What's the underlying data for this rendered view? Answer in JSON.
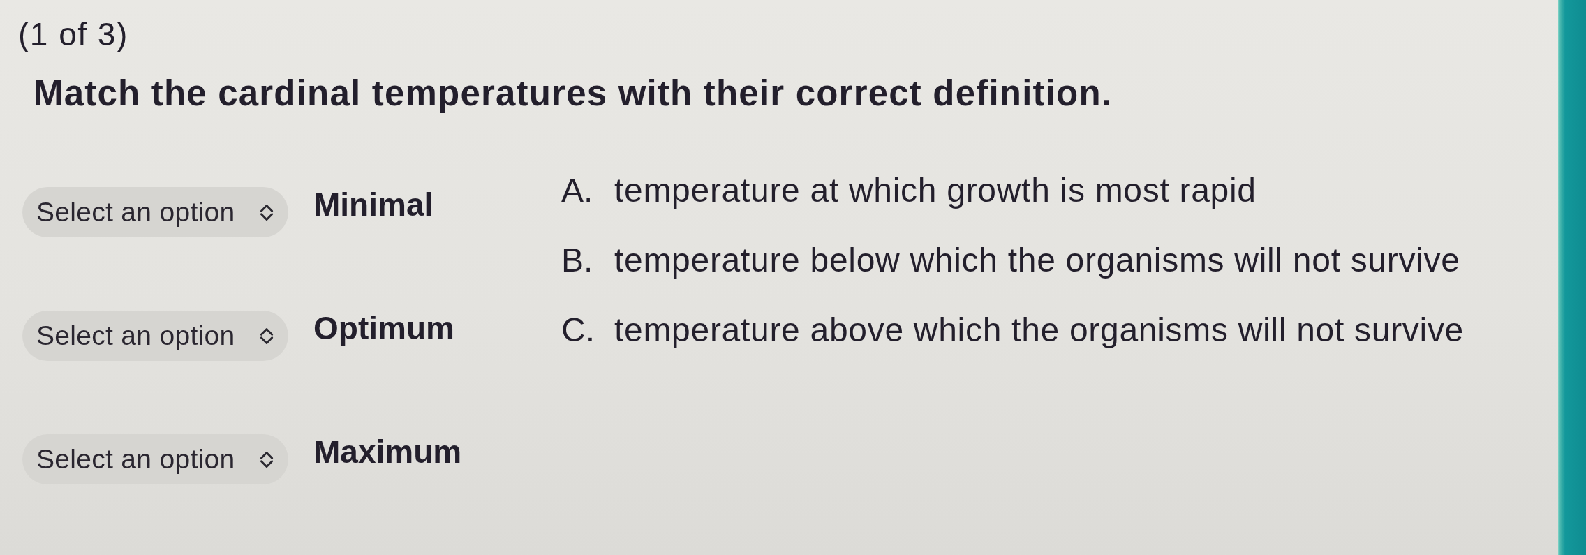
{
  "header": {
    "progress": "(1 of 3)",
    "question": "Match the cardinal temperatures with their correct definition."
  },
  "matches": [
    {
      "select": {
        "placeholder": "Select an option"
      },
      "term": "Minimal"
    },
    {
      "select": {
        "placeholder": "Select an option"
      },
      "term": "Optimum"
    },
    {
      "select": {
        "placeholder": "Select an option"
      },
      "term": "Maximum"
    }
  ],
  "definitions": [
    {
      "letter": "A.",
      "text": "temperature at which growth is most rapid"
    },
    {
      "letter": "B.",
      "text": "temperature below which the organisms will not survive"
    },
    {
      "letter": "C.",
      "text": "temperature above which the organisms will not survive"
    }
  ]
}
